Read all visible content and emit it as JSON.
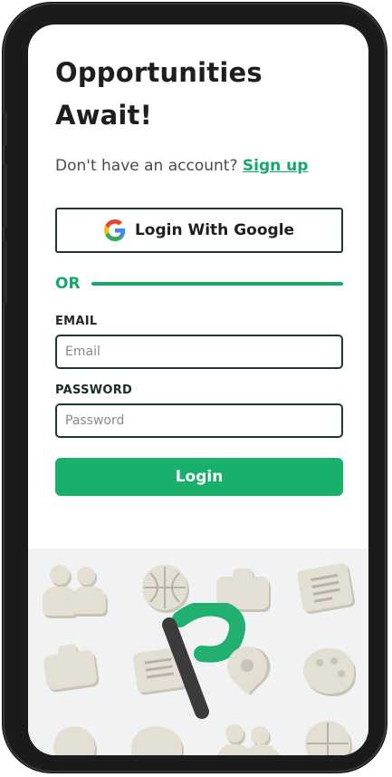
{
  "login": {
    "title_line1": "Opportunities",
    "title_line2": "Await!",
    "signup_prompt": "Don't have an account?",
    "signup_link": "Sign up",
    "google_button": "Login With Google",
    "divider": "OR",
    "email_label": "EMAIL",
    "email_placeholder": "Email",
    "password_label": "PASSWORD",
    "password_placeholder": "Password",
    "login_button": "Login"
  },
  "colors": {
    "accent": "#16a86a",
    "button": "#19b06c",
    "border": "#1f3a2a",
    "illustration_bg": "#f1f2f4"
  },
  "illustration": {
    "icons": [
      "users-icon",
      "basketball-icon",
      "briefcase-icon",
      "document-icon",
      "palette-icon",
      "location-pin-icon",
      "logo-p-icon"
    ]
  }
}
